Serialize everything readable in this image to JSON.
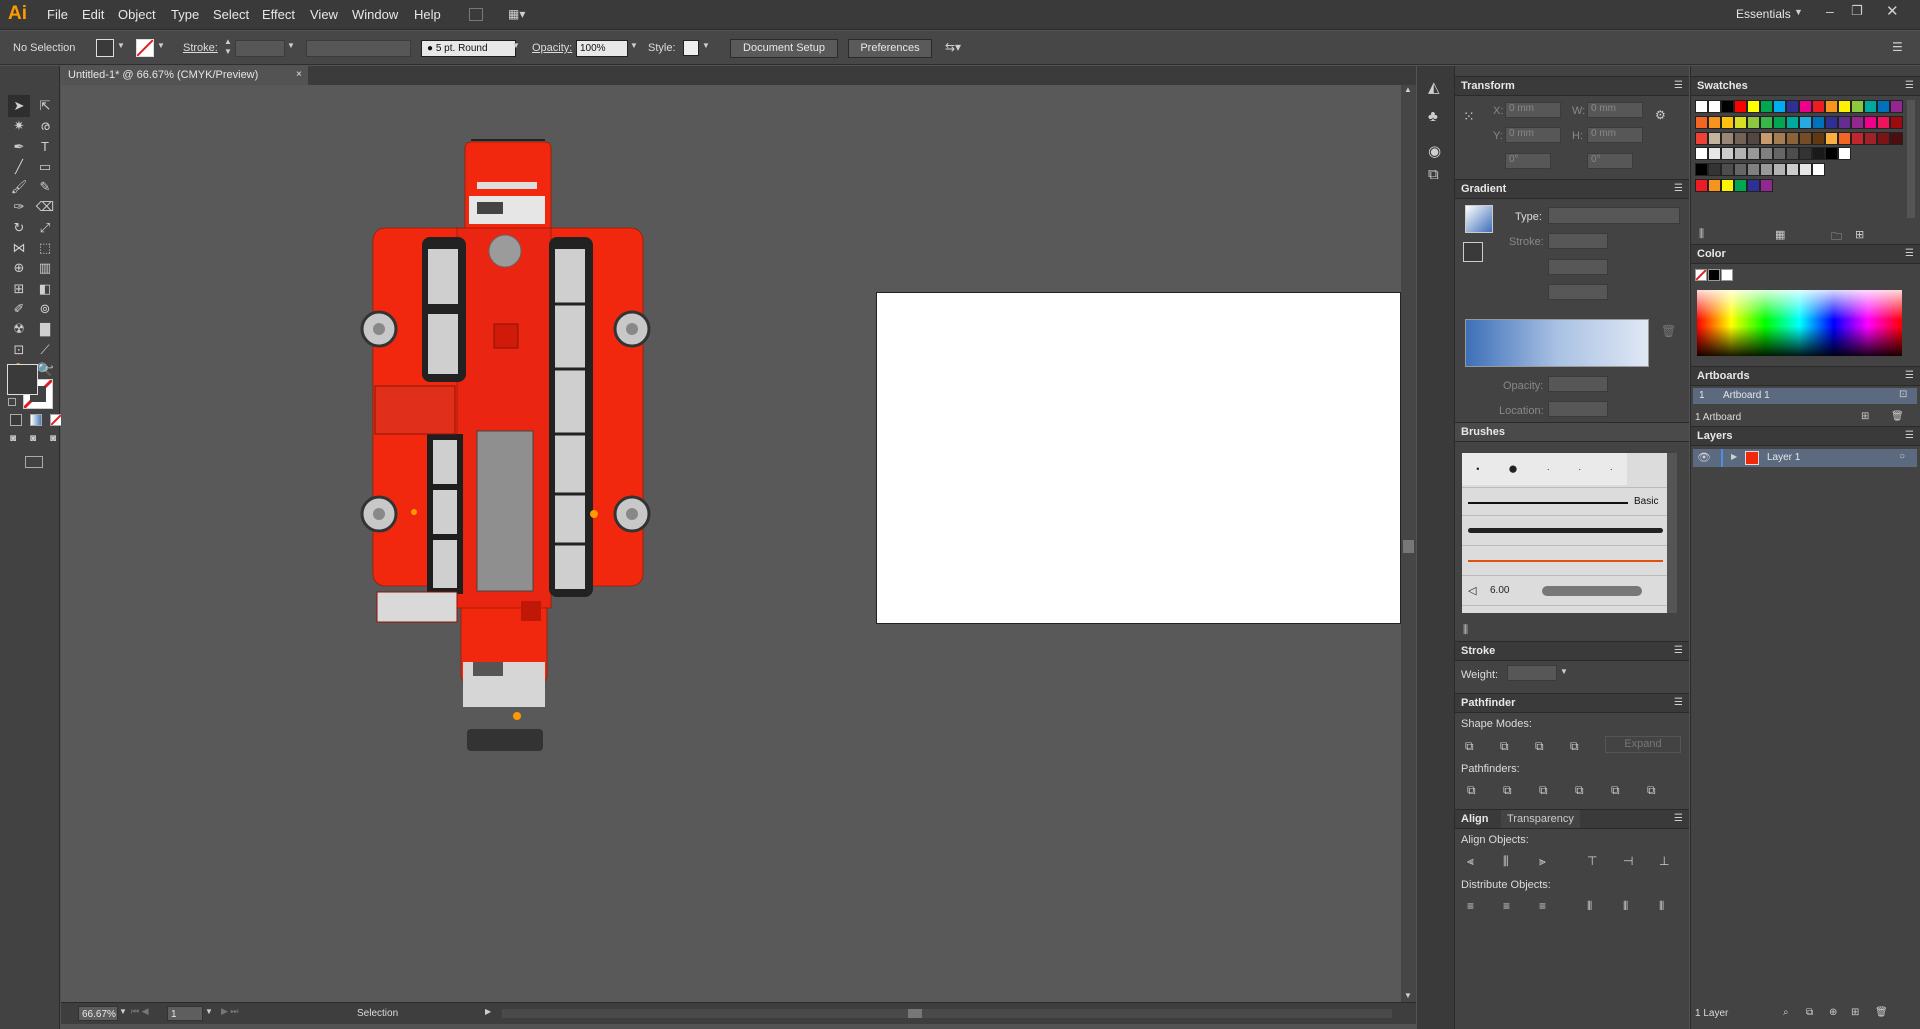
{
  "app": {
    "logo": "Ai",
    "workspace": "Essentials"
  },
  "menu": [
    "File",
    "Edit",
    "Object",
    "Type",
    "Select",
    "Effect",
    "View",
    "Window",
    "Help"
  ],
  "control": {
    "selection": "No Selection",
    "stroke_label": "Stroke:",
    "brush": "5 pt. Round",
    "opacity_label": "Opacity:",
    "opacity_value": "100%",
    "style_label": "Style:",
    "doc_setup": "Document Setup",
    "preferences": "Preferences"
  },
  "document": {
    "tab": "Untitled-1* @ 66.67% (CMYK/Preview)"
  },
  "status": {
    "zoom": "66.67%",
    "artboard_num": "1",
    "tool": "Selection"
  },
  "transform": {
    "title": "Transform",
    "x_label": "X:",
    "x": "0 mm",
    "y_label": "Y:",
    "y": "0 mm",
    "w_label": "W:",
    "w": "0 mm",
    "h_label": "H:",
    "h": "0 mm",
    "rot": "0°",
    "shear": "0°"
  },
  "gradient": {
    "title": "Gradient",
    "type_label": "Type:",
    "stroke_label": "Stroke:",
    "opacity_label": "Opacity:",
    "location_label": "Location:"
  },
  "brushes": {
    "title": "Brushes",
    "basic": "Basic",
    "size": "6.00"
  },
  "stroke": {
    "title": "Stroke",
    "weight_label": "Weight:"
  },
  "pathfinder": {
    "title": "Pathfinder",
    "shape_modes": "Shape Modes:",
    "expand": "Expand",
    "pathfinders": "Pathfinders:"
  },
  "align": {
    "title": "Align",
    "tab2": "Transparency",
    "align_objects": "Align Objects:",
    "distribute_objects": "Distribute Objects:"
  },
  "swatches": {
    "title": "Swatches"
  },
  "color": {
    "title": "Color"
  },
  "artboards": {
    "title": "Artboards",
    "items": [
      {
        "num": "1",
        "name": "Artboard 1"
      }
    ],
    "footer": "1 Artboard"
  },
  "layers": {
    "title": "Layers",
    "items": [
      {
        "name": "Layer 1"
      }
    ],
    "footer": "1 Layer"
  },
  "colors": {
    "bus_red": "#f2280e",
    "accent_orange": "#ff9a00"
  }
}
